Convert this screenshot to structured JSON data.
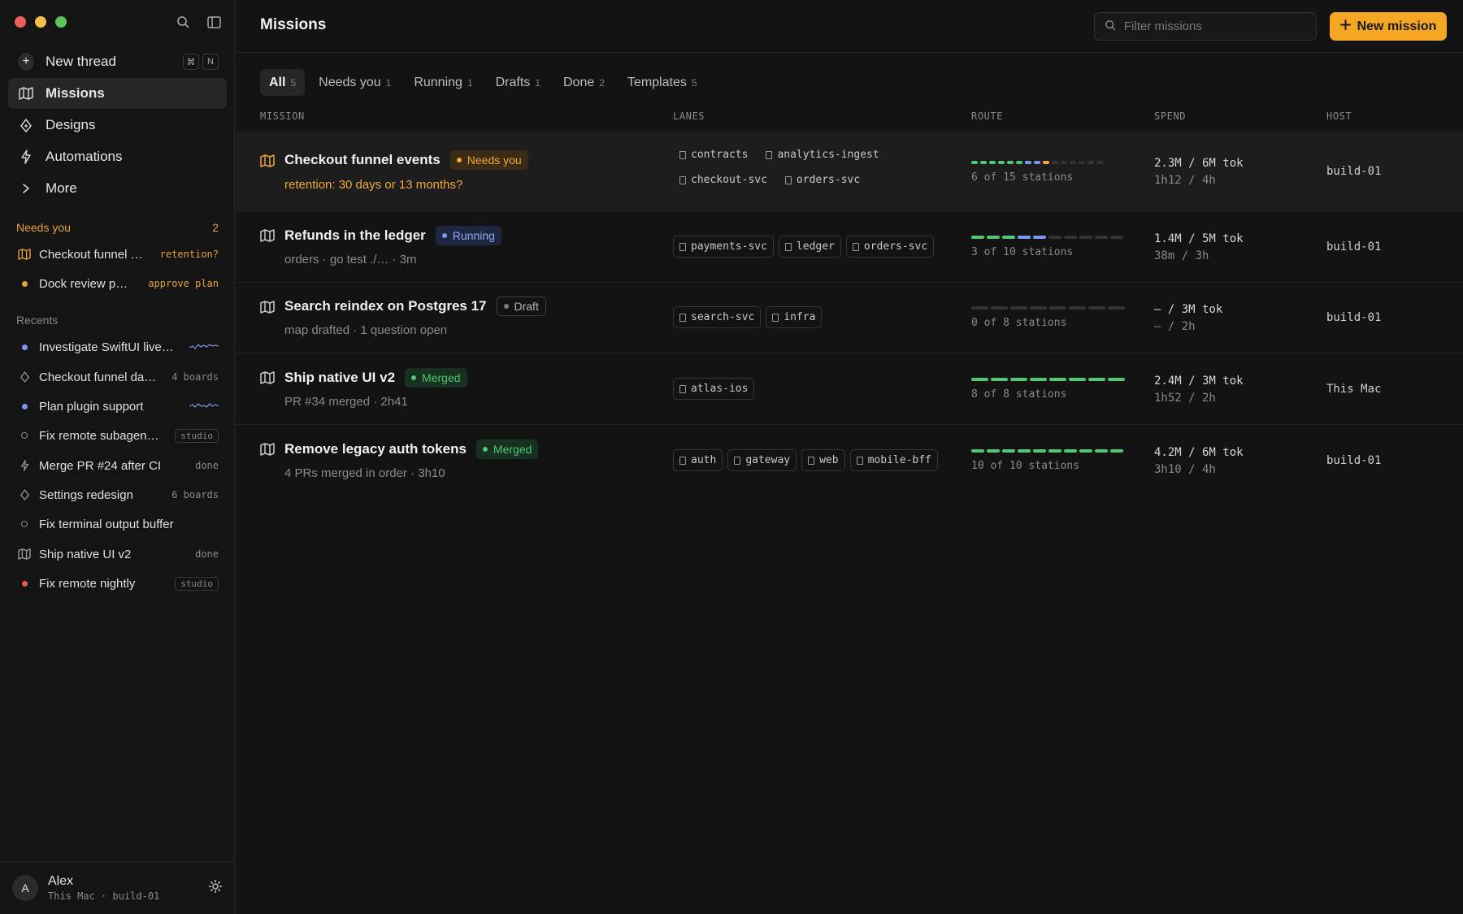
{
  "sidebar": {
    "nav": [
      {
        "label": "New thread",
        "icon": "plus-circle-icon",
        "kbd": [
          "⌘",
          "N"
        ]
      },
      {
        "label": "Missions",
        "icon": "map-icon",
        "active": true
      },
      {
        "label": "Designs",
        "icon": "pen-nib-icon"
      },
      {
        "label": "Automations",
        "icon": "lightning-icon"
      },
      {
        "label": "More",
        "icon": "chevron-right-icon"
      }
    ],
    "needs_you": {
      "title": "Needs you",
      "count": "2",
      "items": [
        {
          "label": "Checkout funnel …",
          "meta": "retention?"
        },
        {
          "label": "Dock review p…",
          "meta": "approve plan"
        }
      ]
    },
    "recents": {
      "title": "Recents",
      "items": [
        {
          "label": "Investigate SwiftUI live…",
          "meta": ""
        },
        {
          "label": "Checkout funnel da…",
          "meta": "4 boards"
        },
        {
          "label": "Plan plugin support",
          "meta": ""
        },
        {
          "label": "Fix remote subagen…",
          "meta": "studio"
        },
        {
          "label": "Merge PR #24 after CI",
          "meta": "done"
        },
        {
          "label": "Settings redesign",
          "meta": "6 boards"
        },
        {
          "label": "Fix terminal output buffer",
          "meta": ""
        },
        {
          "label": "Ship native UI v2",
          "meta": "done"
        },
        {
          "label": "Fix remote nightly",
          "meta": "studio"
        }
      ]
    },
    "user": {
      "initial": "A",
      "name": "Alex",
      "sub": "This Mac · build-01"
    }
  },
  "header": {
    "title": "Missions",
    "search_placeholder": "Filter missions",
    "new_button": "New mission"
  },
  "tabs": [
    {
      "label": "All",
      "count": "5"
    },
    {
      "label": "Needs you",
      "count": "1"
    },
    {
      "label": "Running",
      "count": "1"
    },
    {
      "label": "Drafts",
      "count": "1"
    },
    {
      "label": "Done",
      "count": "2"
    },
    {
      "label": "Templates",
      "count": "5"
    }
  ],
  "columns": {
    "mission": "MISSION",
    "lanes": "LANES",
    "route": "ROUTE",
    "spend": "SPEND",
    "host": "HOST"
  },
  "missions": [
    {
      "title": "Checkout funnel events",
      "badge": "Needs you",
      "subtitle": "retention: 30 days or 13 months?",
      "lanes": [
        "contracts",
        "analytics-ingest",
        "checkout-svc",
        "orders-svc"
      ],
      "route_label": "6 of 15 stations",
      "spend_tokens": "2.3M / 6M tok",
      "spend_time": "1h12 / 4h",
      "host": "build-01"
    },
    {
      "title": "Refunds in the ledger",
      "badge": "Running",
      "subtitle": "orders · go test ./… · 3m",
      "lanes": [
        "payments-svc",
        "ledger",
        "orders-svc"
      ],
      "route_label": "3 of 10 stations",
      "spend_tokens": "1.4M / 5M tok",
      "spend_time": "38m / 3h",
      "host": "build-01"
    },
    {
      "title": "Search reindex on Postgres 17",
      "badge": "Draft",
      "subtitle": "map drafted · 1 question open",
      "lanes": [
        "search-svc",
        "infra"
      ],
      "route_label": "0 of 8 stations",
      "spend_tokens": "– / 3M tok",
      "spend_time": "– / 2h",
      "host": "build-01"
    },
    {
      "title": "Ship native UI v2",
      "badge": "Merged",
      "subtitle": "PR #34 merged · 2h41",
      "lanes": [
        "atlas-ios"
      ],
      "route_label": "8 of 8 stations",
      "spend_tokens": "2.4M / 3M tok",
      "spend_time": "1h52 / 2h",
      "host": "This Mac"
    },
    {
      "title": "Remove legacy auth tokens",
      "badge": "Merged",
      "subtitle": "4 PRs merged in order · 3h10",
      "lanes": [
        "auth",
        "gateway",
        "web",
        "mobile-bff"
      ],
      "route_label": "10 of 10 stations",
      "spend_tokens": "4.2M / 6M tok",
      "spend_time": "3h10 / 4h",
      "host": "build-01"
    }
  ],
  "colors": {
    "accent": "#f5a623",
    "amber": "#f0a83a",
    "running": "#7d97f0",
    "merged": "#4fc775",
    "background": "#131313"
  }
}
